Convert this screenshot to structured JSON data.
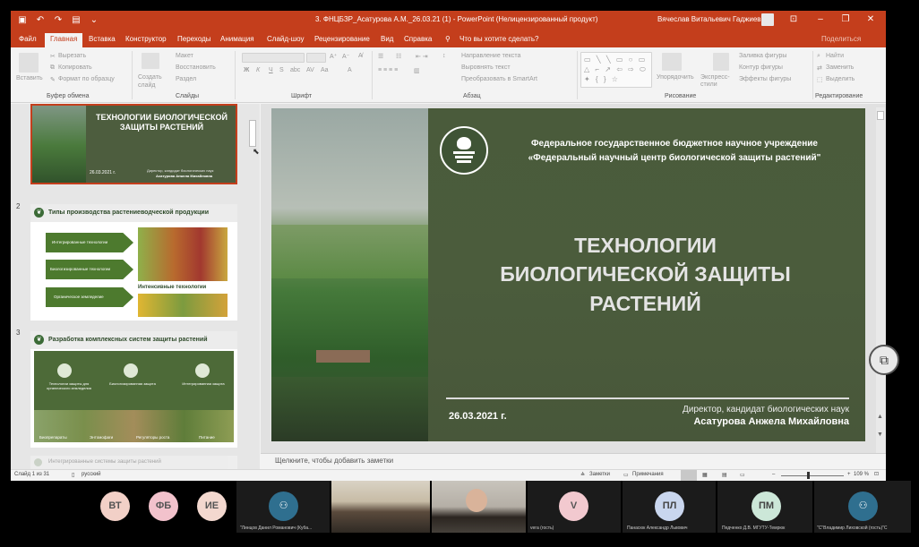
{
  "titlebar": {
    "doc_title": "3. ФНЦБЗР_Асатурова А.М._26.03.21 (1)  -  PowerPoint (Нелицензированный продукт)",
    "user_name": "Вячеслав Витальевич Гаджиев",
    "accent": "#c43e1c"
  },
  "menu": [
    "Файл",
    "Главная",
    "Вставка",
    "Конструктор",
    "Переходы",
    "Анимация",
    "Слайд-шоу",
    "Рецензирование",
    "Вид",
    "Справка"
  ],
  "tellme": "Что вы хотите сделать?",
  "share": "Поделиться",
  "ribbon": {
    "paste": "Вставить",
    "cut": "Вырезать",
    "copy": "Копировать",
    "format_painter": "Формат по образцу",
    "new_slide": "Создать слайд",
    "layout": "Макет",
    "reset": "Восстановить",
    "section": "Раздел",
    "text_direction": "Направление текста",
    "align_text": "Выровнять текст",
    "smartart": "Преобразовать в SmartArt",
    "arrange": "Упорядочить",
    "quick_styles": "Экспресс-стили",
    "shape_fill": "Заливка фигуры",
    "shape_outline": "Контур фигуры",
    "shape_effects": "Эффекты фигуры",
    "find": "Найти",
    "replace": "Заменить",
    "select": "Выделить",
    "groups": {
      "clipboard": "Буфер обмена",
      "slides": "Слайды",
      "font": "Шрифт",
      "paragraph": "Абзац",
      "drawing": "Рисование",
      "editing": "Редактирование"
    }
  },
  "thumbs": {
    "s1": {
      "title": "ТЕХНОЛОГИИ БИОЛОГИЧЕСКОЙ ЗАЩИТЫ РАСТЕНИЙ",
      "date": "26.03.2021 г.",
      "author1": "Директор, кандидат биологических наук",
      "author2": "Асатурова Анжела Михайловна"
    },
    "s2": {
      "num": "2",
      "title": "Типы производства растениеводческой продукции",
      "items": [
        "Интегрированные технологии",
        "Биологизированные технологии",
        "Органическое земледелие"
      ],
      "intensive": "Интенсивные технологии"
    },
    "s3": {
      "num": "3",
      "title": "Разработка комплексных систем защиты растений",
      "cols": [
        "Технологии защиты для органического земледелия",
        "Биологизированная защита",
        "Интегрированная защита"
      ],
      "strip": [
        "Биопрепараты",
        "Энтомофаги",
        "Регуляторы роста",
        "Питание"
      ]
    },
    "s4": {
      "title": "Интегрированные системы защиты растений"
    }
  },
  "slide": {
    "org_line1": "Федеральное государственное бюджетное научное учреждение",
    "org_line2": "«Федеральный научный центр биологической защиты растений\"",
    "title1": "ТЕХНОЛОГИИ",
    "title2": "БИОЛОГИЧЕСКОЙ  ЗАЩИТЫ",
    "title3": "РАСТЕНИЙ",
    "date": "26.03.2021 г.",
    "author1": "Директор, кандидат биологических наук",
    "author2": "Асатурова Анжела Михайловна"
  },
  "notes": "Щелкните, чтобы добавить заметки",
  "status": {
    "slide": "Слайд 1 из 31",
    "lang": "русский",
    "notes_btn": "Заметки",
    "comments_btn": "Примечания",
    "zoom": "109 %"
  },
  "participants": {
    "c1": "ВТ",
    "c2": "ФБ",
    "c3": "ИЕ",
    "n1": "\"Линцов Данил Романович (Куба...",
    "v": "V",
    "vname": "vera (гость)",
    "pl": "ПЛ",
    "plname": "Панасюк Александр Львович",
    "pm": "ПМ",
    "pmname": "Педченко Д.В. МГУТУ-Темрюк",
    "n2": "\"С\"Владимир Лиховской (гость)\"С"
  }
}
